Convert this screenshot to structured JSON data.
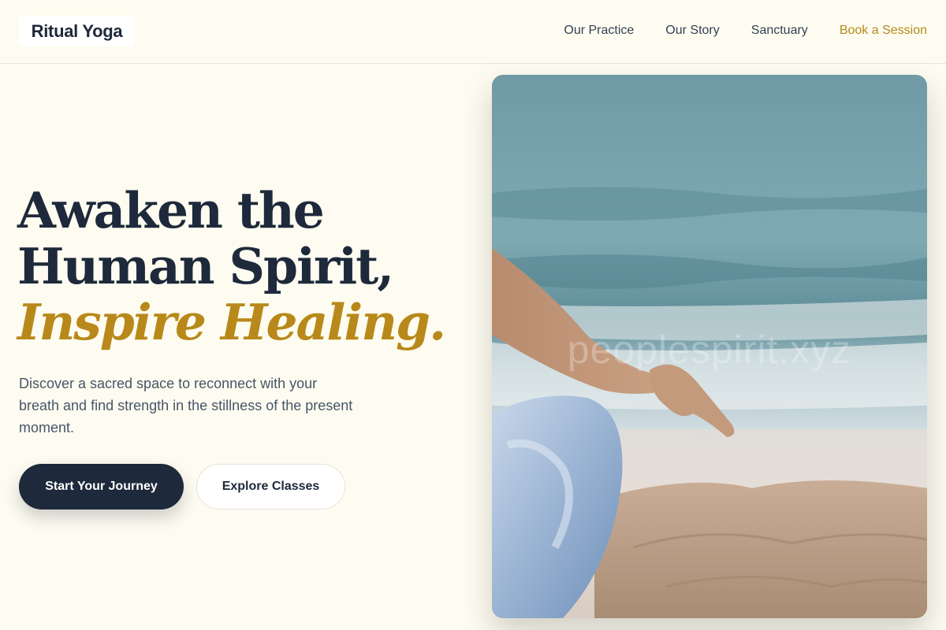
{
  "header": {
    "logo": "Ritual Yoga",
    "nav": [
      {
        "label": "Our Practice"
      },
      {
        "label": "Our Story"
      },
      {
        "label": "Sanctuary"
      },
      {
        "label": "Book a Session"
      }
    ]
  },
  "hero": {
    "headline_line1": "Awaken the",
    "headline_line2": "Human Spirit,",
    "headline_accent": "Inspire Healing.",
    "subtext": "Discover a sacred space to reconnect with your breath and find strength in the stillness of the present moment.",
    "primary_button": "Start Your Journey",
    "secondary_button": "Explore Classes",
    "image_watermark": "peoplespirit.xyz"
  },
  "colors": {
    "background": "#fefcf0",
    "navy": "#1e293b",
    "gold_accent": "#b8891a"
  }
}
